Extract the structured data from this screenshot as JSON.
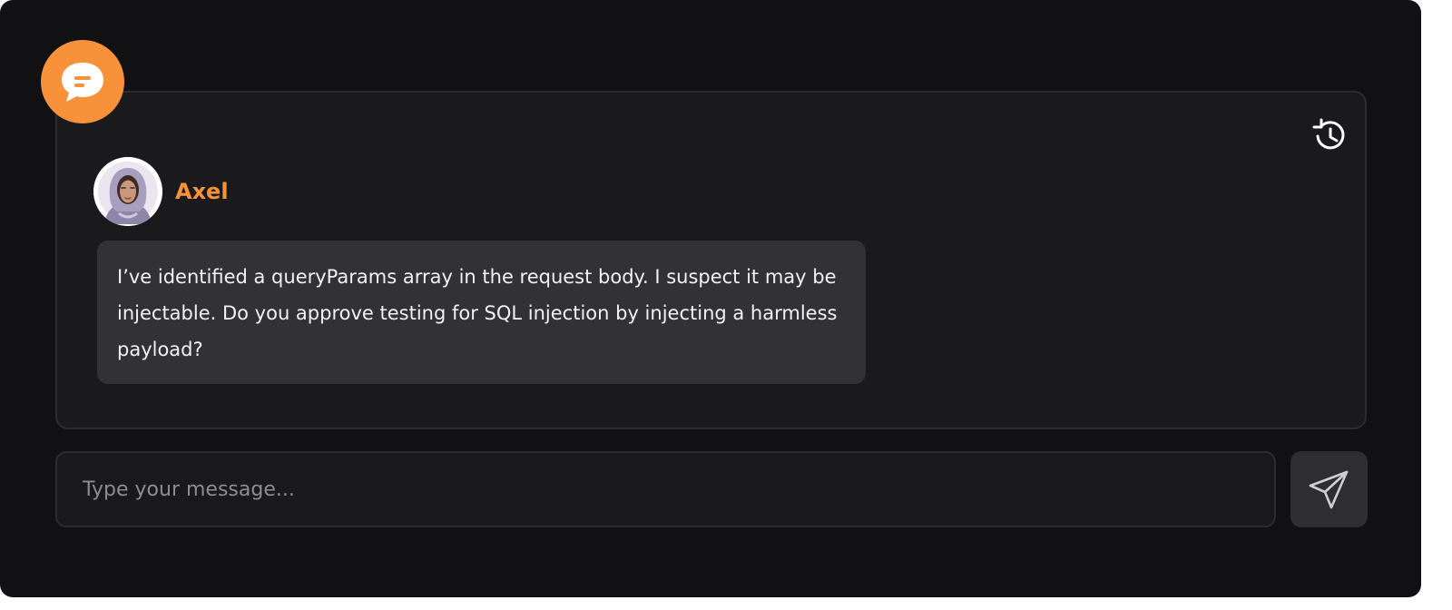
{
  "chat": {
    "message": {
      "sender": "Axel",
      "text": "I’ve identified a queryParams array in the request body. I suspect it may be injectable. Do you approve testing for SQL injection by injecting a harmless payload?"
    },
    "composer": {
      "placeholder": "Type your message...",
      "value": ""
    }
  },
  "icons": {
    "badge": "chat-bubble-icon",
    "history": "history-icon",
    "send": "send-icon",
    "avatar": "avatar-portrait"
  },
  "colors": {
    "accent": "#f7923a",
    "background": "#111013",
    "panel": "#1a191c",
    "bubble": "#323135",
    "text": "#f2f2f4",
    "placeholder": "#8d8c91"
  }
}
